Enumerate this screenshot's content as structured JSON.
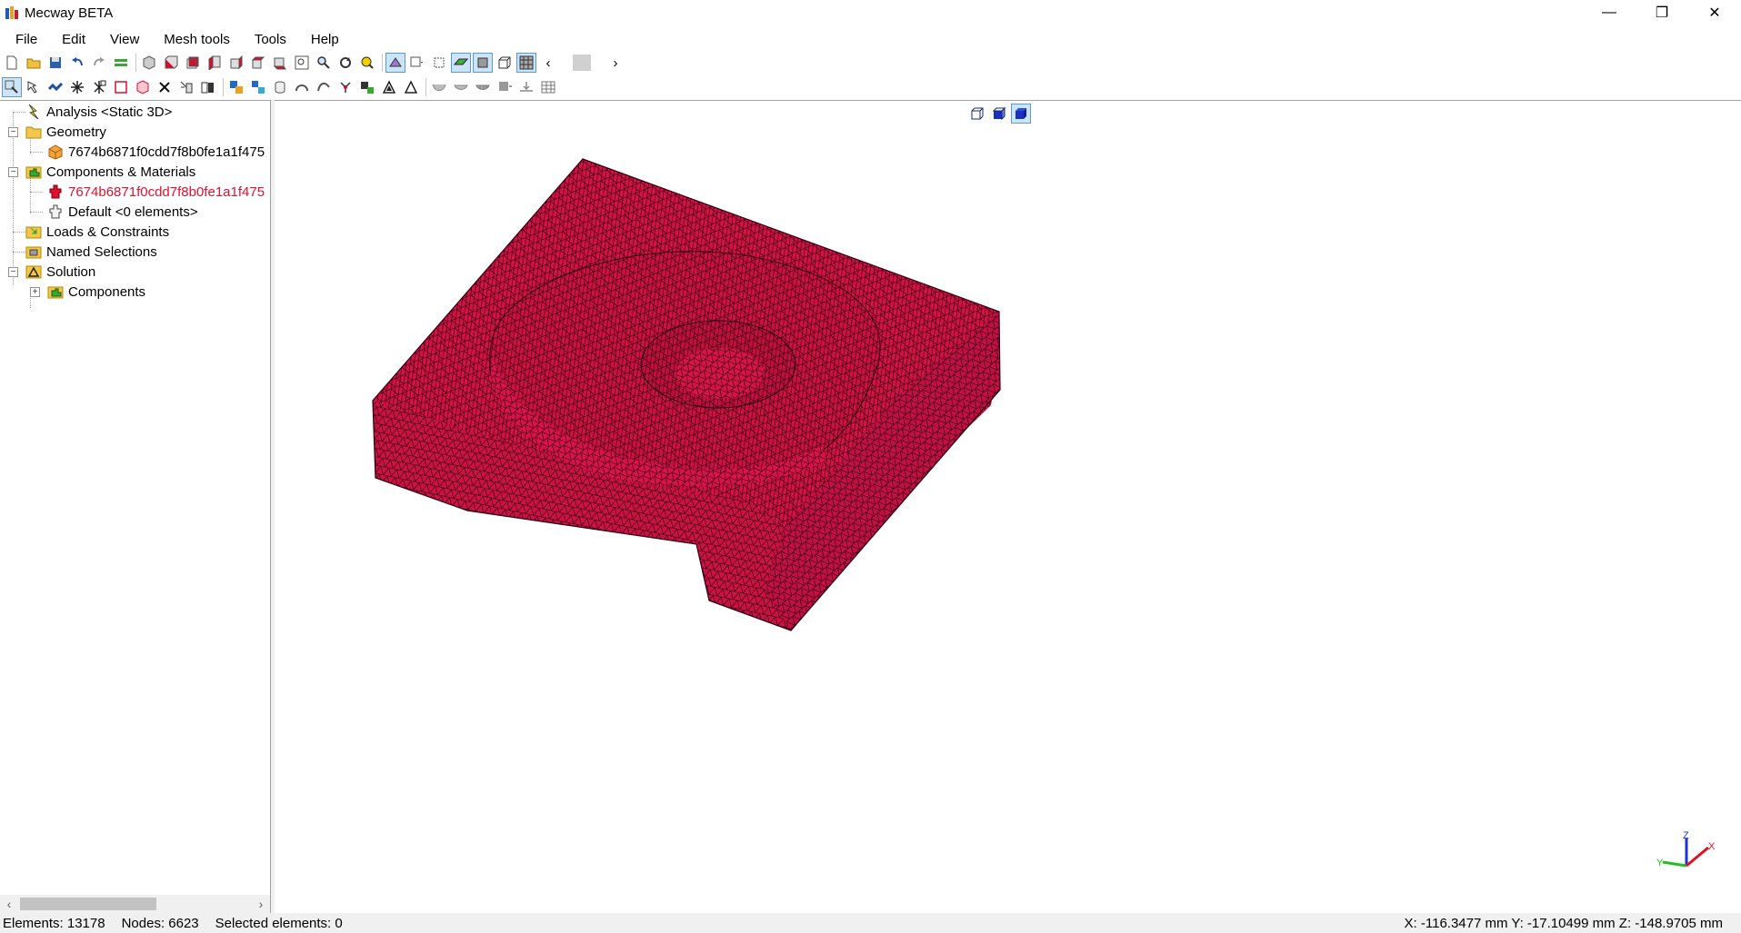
{
  "window": {
    "title": "Mecway BETA",
    "minimize_glyph": "—",
    "restore_glyph": "❐",
    "close_glyph": "✕"
  },
  "menu": [
    "File",
    "Edit",
    "View",
    "Mesh tools",
    "Tools",
    "Help"
  ],
  "toolbar": {
    "row1_icons": [
      "new-file-icon",
      "open-folder-icon",
      "save-icon",
      "undo-icon",
      "redo-icon",
      "layers-icon",
      "view-iso-icon",
      "view-front-icon",
      "view-back-icon",
      "view-left-icon",
      "view-right-icon",
      "view-top-icon",
      "view-bottom-icon",
      "zoom-fit-icon",
      "zoom-icon",
      "rotate-icon",
      "zoom-all-icon",
      "perspective-icon",
      "display-dropdown-icon",
      "select-box-icon",
      "shaded-icon",
      "shaded-edges-icon",
      "wireframe-icon",
      "mesh-icon",
      "scroll-left-icon",
      "color-swatch-icon",
      "scroll-right-icon"
    ],
    "row2_icons": [
      "select-arrow-icon",
      "select-connected-icon",
      "select-faces-icon",
      "explode-icon",
      "mirror-icon",
      "rectangle-icon",
      "cube-icon",
      "delete-icon",
      "extrude-icon",
      "refine-icon",
      "merge-icon",
      "split-icon",
      "cylinder-icon",
      "sweep-icon",
      "bend-icon",
      "graph-icon",
      "nodes-icon",
      "triangle-icon",
      "triangle-outline-icon",
      "bowl-icon",
      "bowl-flat-icon",
      "bowl-mesh-icon",
      "dash-icon",
      "align-icon",
      "table-icon"
    ],
    "scroll_left": "‹",
    "scroll_right": "›"
  },
  "tree": {
    "items": [
      {
        "label": "Analysis <Static 3D>",
        "icon": "analysis-lightning-icon",
        "color": "#000000"
      },
      {
        "label": "Geometry",
        "icon": "folder-icon",
        "color": "#000000"
      },
      {
        "label": "7674b6871f0cdd7f8b0fe1a1f475",
        "icon": "geometry-part-icon",
        "color": "#000000"
      },
      {
        "label": "Components & Materials",
        "icon": "components-icon",
        "color": "#000000"
      },
      {
        "label": "7674b6871f0cdd7f8b0fe1a1f475",
        "icon": "component-red-icon",
        "color": "#e0102f"
      },
      {
        "label": "Default <0 elements>",
        "icon": "component-gray-icon",
        "color": "#000000"
      },
      {
        "label": "Loads & Constraints",
        "icon": "loads-icon",
        "color": "#000000"
      },
      {
        "label": "Named Selections",
        "icon": "named-selections-icon",
        "color": "#000000"
      },
      {
        "label": "Solution",
        "icon": "solution-triangle-icon",
        "color": "#000000"
      },
      {
        "label": "Components",
        "icon": "components-icon",
        "color": "#000000"
      }
    ],
    "expanded_glyph": "−",
    "collapsed_glyph": "+"
  },
  "scrollbar": {
    "left": "‹",
    "right": "›"
  },
  "view_tools": [
    "wire-cube-icon",
    "solid-cube-icon",
    "blue-cube-icon"
  ],
  "viewport": {
    "mesh_color": "#d41244",
    "mesh_line_color": "#1a0008",
    "axes": {
      "x": "X",
      "y": "Y",
      "z": "Z"
    }
  },
  "status": {
    "elements": "Elements: 13178",
    "nodes": "Nodes: 6623",
    "selected": "Selected elements: 0",
    "coords": "X: -116.3477 mm Y: -17.10499 mm Z: -148.9705 mm"
  }
}
